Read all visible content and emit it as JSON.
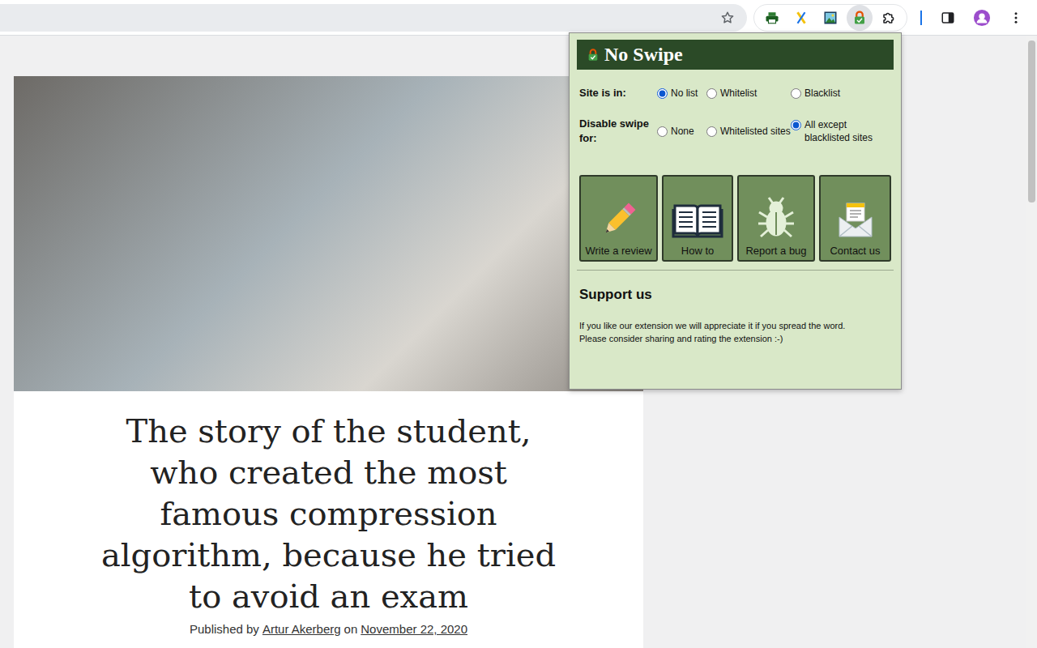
{
  "browser": {
    "extensions": [
      {
        "kind": "printer",
        "selected": false
      },
      {
        "kind": "x-logo",
        "selected": false
      },
      {
        "kind": "image",
        "selected": false
      },
      {
        "kind": "lock",
        "selected": true
      },
      {
        "kind": "puzzle",
        "selected": false
      }
    ]
  },
  "article": {
    "title_lines": [
      "The story of the student,",
      "who created the most",
      "famous compression",
      "algorithm, because he tried",
      "to avoid an exam"
    ],
    "byline_prefix": "Published by",
    "author": "Artur Akerberg",
    "byline_middle": "on",
    "date": "November 22, 2020"
  },
  "popup": {
    "title": "No Swipe",
    "groups": [
      {
        "label": "Site is in:",
        "options": [
          {
            "label": "No list",
            "selected": true
          },
          {
            "label": "Whitelist",
            "selected": false
          },
          {
            "label": "Blacklist",
            "selected": false
          }
        ]
      },
      {
        "label": "Disable swipe for:",
        "options": [
          {
            "label": "None",
            "selected": false
          },
          {
            "label": "Whitelisted sites",
            "selected": false
          },
          {
            "label": "All except blacklisted sites",
            "selected": true
          }
        ]
      }
    ],
    "buttons": [
      {
        "label": "Write a review",
        "kind": "pencil"
      },
      {
        "label": "How to",
        "kind": "book"
      },
      {
        "label": "Report a bug",
        "kind": "bug"
      },
      {
        "label": "Contact us",
        "kind": "envelope"
      }
    ],
    "support": {
      "heading": "Support us",
      "lines": [
        "If you like our extension we will appreciate it if you spread the word.",
        "Please consider sharing and rating the extension :-)"
      ]
    }
  }
}
